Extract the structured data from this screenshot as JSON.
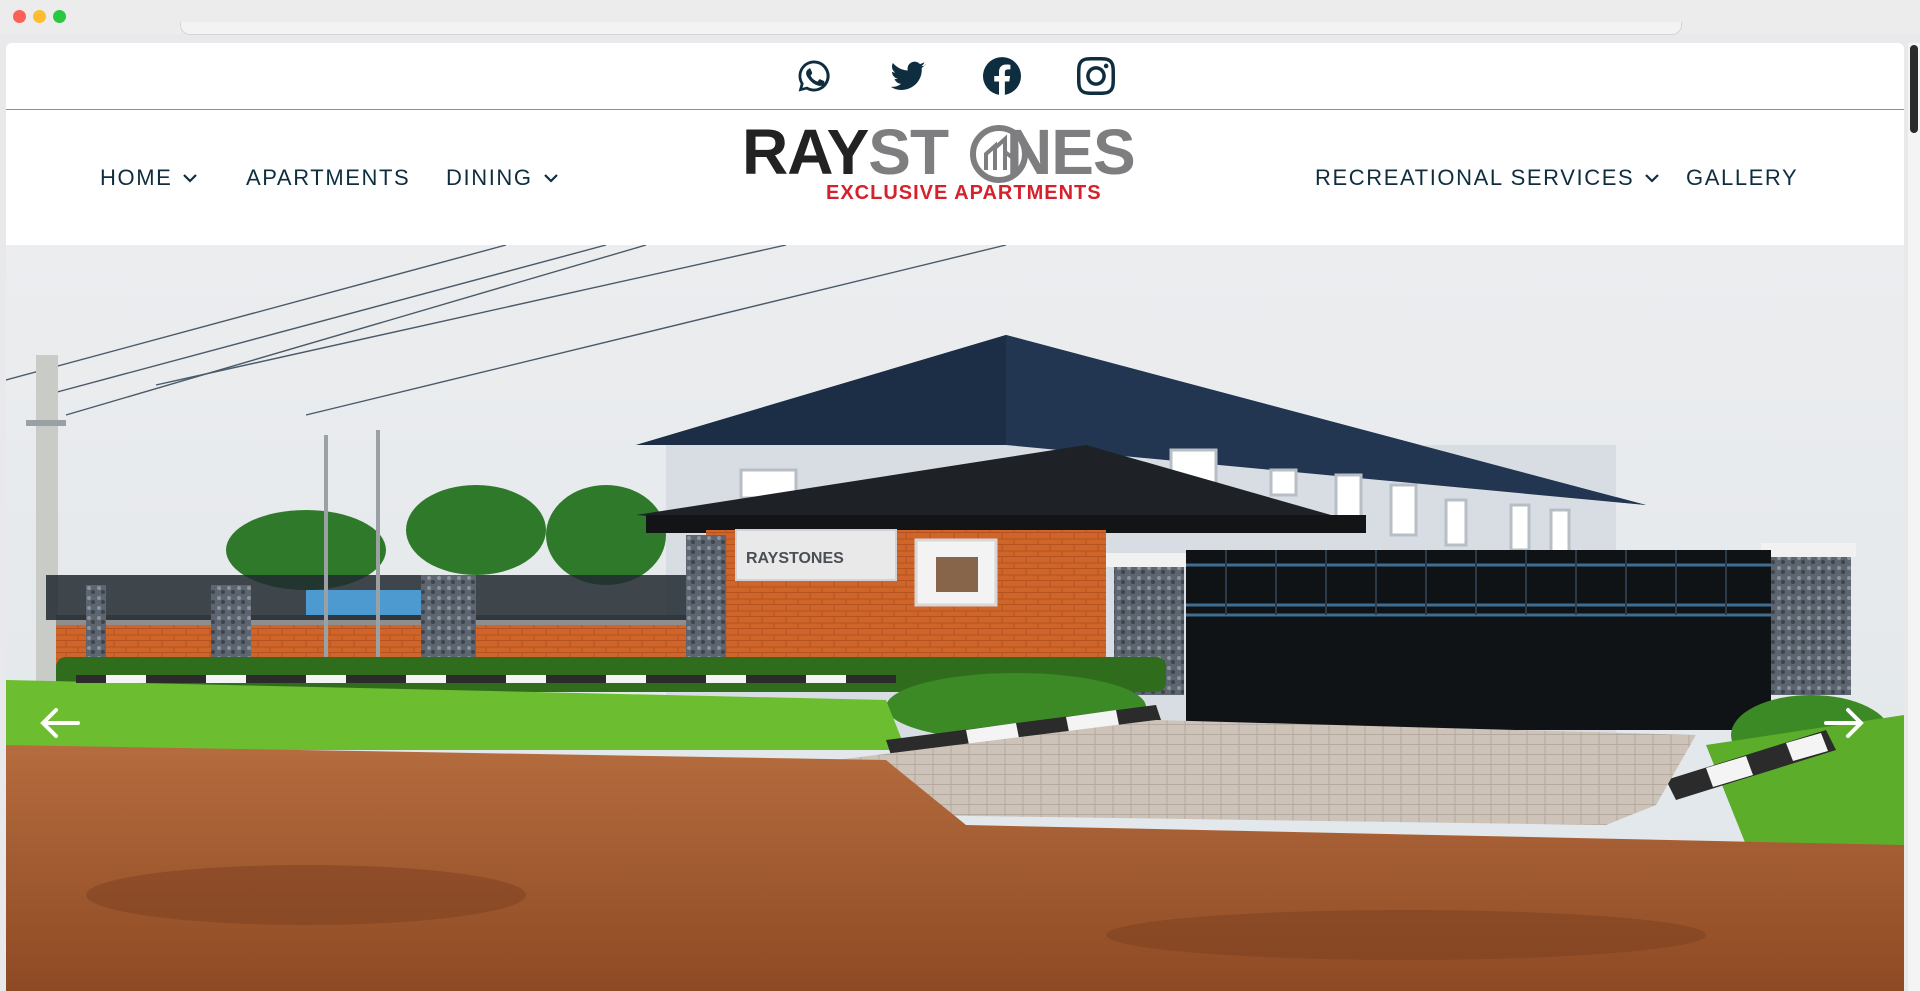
{
  "window": {
    "controls": [
      "close",
      "minimize",
      "zoom"
    ]
  },
  "social": {
    "icons": [
      "whatsapp-icon",
      "twitter-icon",
      "facebook-icon",
      "instagram-icon"
    ],
    "color": "#0e2e3f"
  },
  "nav": {
    "home_label": "HOME",
    "apartments_label": "APARTMENTS",
    "dining_label": "DINING",
    "recreational_label": "RECREATIONAL SERVICES",
    "gallery_label": "GALLERY",
    "text_color": "#0e2e3f"
  },
  "logo": {
    "brand_part1": "RAY",
    "brand_part2": "ST",
    "brand_part3": "NES",
    "tagline": "EXCLUSIVE APARTMENTS",
    "brand_dark": "#222222",
    "brand_grey": "#7e7e80",
    "tagline_color": "#d6202c"
  },
  "hero": {
    "sign_text": "RAYSTONES",
    "prev_icon": "arrow-left-icon",
    "next_icon": "arrow-right-icon"
  }
}
